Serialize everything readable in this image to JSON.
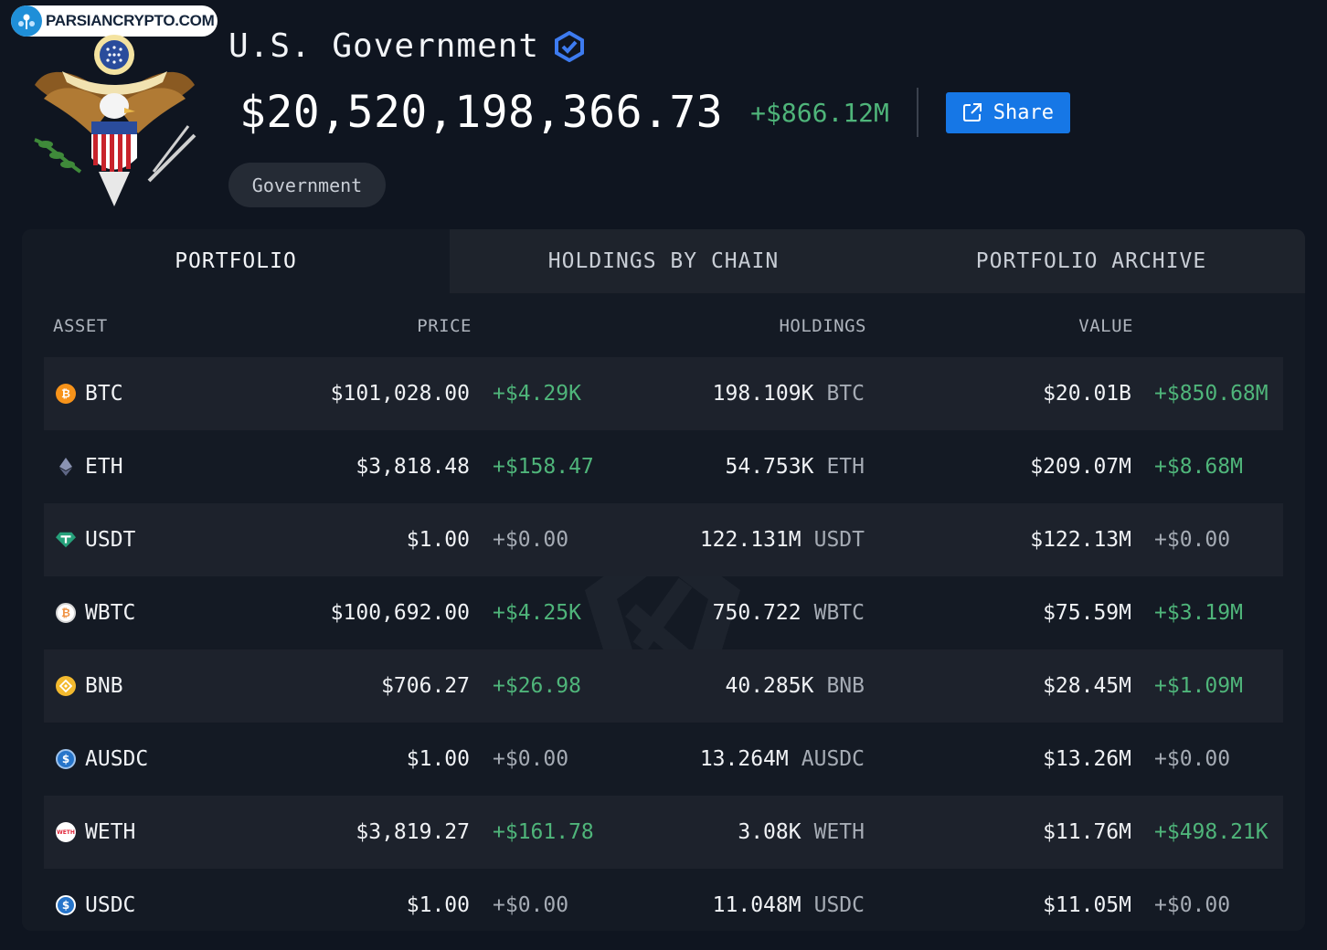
{
  "watermark": {
    "text": "PARSIANCRYPTO.COM"
  },
  "entity": {
    "name": "U.S. Government",
    "verified_icon": "verified-badge-icon",
    "total_balance": "$20,520,198,366.73",
    "total_change": "+$866.12M",
    "share_label": "Share",
    "tag": "Government"
  },
  "colors": {
    "positive": "#4fb57a",
    "neutral": "#a5abb4",
    "accent": "#1677e6",
    "background": "#0f1520"
  },
  "tabs": [
    {
      "label": "PORTFOLIO",
      "active": true
    },
    {
      "label": "HOLDINGS BY CHAIN",
      "active": false
    },
    {
      "label": "PORTFOLIO ARCHIVE",
      "active": false
    }
  ],
  "columns": {
    "asset": "ASSET",
    "price": "PRICE",
    "holdings": "HOLDINGS",
    "value": "VALUE"
  },
  "assets": [
    {
      "symbol": "BTC",
      "icon": "bitcoin-icon",
      "price": "$101,028.00",
      "price_change": "+$4.29K",
      "holdings": "198.109K",
      "unit": "BTC",
      "value": "$20.01B",
      "value_change": "+$850.68M"
    },
    {
      "symbol": "ETH",
      "icon": "ethereum-icon",
      "price": "$3,818.48",
      "price_change": "+$158.47",
      "holdings": "54.753K",
      "unit": "ETH",
      "value": "$209.07M",
      "value_change": "+$8.68M"
    },
    {
      "symbol": "USDT",
      "icon": "tether-icon",
      "price": "$1.00",
      "price_change": "+$0.00",
      "holdings": "122.131M",
      "unit": "USDT",
      "value": "$122.13M",
      "value_change": "+$0.00"
    },
    {
      "symbol": "WBTC",
      "icon": "wrapped-bitcoin-icon",
      "price": "$100,692.00",
      "price_change": "+$4.25K",
      "holdings": "750.722",
      "unit": "WBTC",
      "value": "$75.59M",
      "value_change": "+$3.19M"
    },
    {
      "symbol": "BNB",
      "icon": "bnb-icon",
      "price": "$706.27",
      "price_change": "+$26.98",
      "holdings": "40.285K",
      "unit": "BNB",
      "value": "$28.45M",
      "value_change": "+$1.09M"
    },
    {
      "symbol": "AUSDC",
      "icon": "ausdc-icon",
      "price": "$1.00",
      "price_change": "+$0.00",
      "holdings": "13.264M",
      "unit": "AUSDC",
      "value": "$13.26M",
      "value_change": "+$0.00"
    },
    {
      "symbol": "WETH",
      "icon": "weth-icon",
      "price": "$3,819.27",
      "price_change": "+$161.78",
      "holdings": "3.08K",
      "unit": "WETH",
      "value": "$11.76M",
      "value_change": "+$498.21K"
    },
    {
      "symbol": "USDC",
      "icon": "usdc-icon",
      "price": "$1.00",
      "price_change": "+$0.00",
      "holdings": "11.048M",
      "unit": "USDC",
      "value": "$11.05M",
      "value_change": "+$0.00"
    }
  ]
}
